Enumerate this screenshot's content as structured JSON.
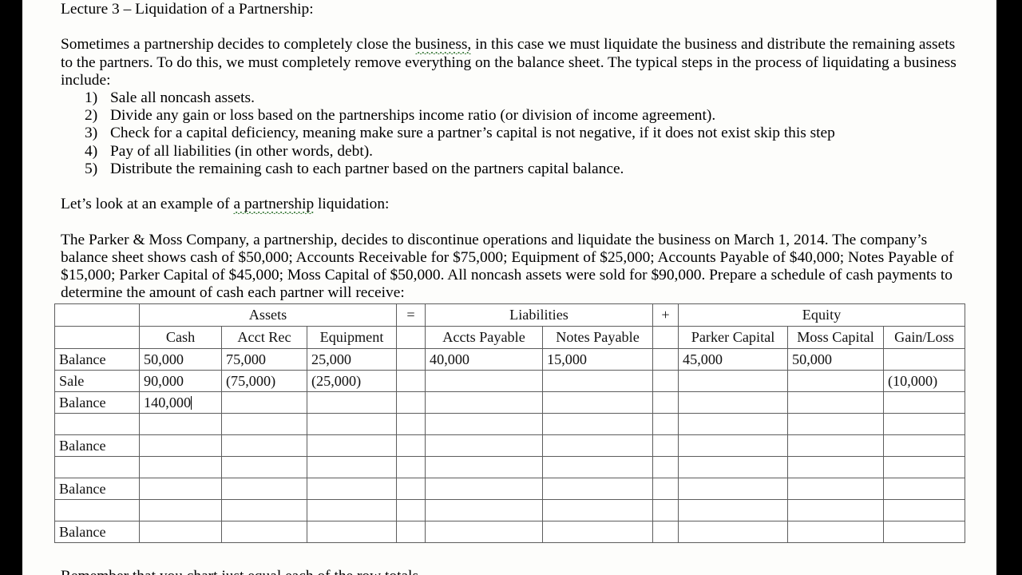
{
  "document": {
    "title_line": "Lecture 3 – Liquidation of a Partnership:",
    "intro_paragraph": "Sometimes a partnership decides to completely close the business, in this case we must liquidate the business and distribute the remaining assets to the partners.  To do this, we must completely remove everything on the balance sheet.  The typical steps in the process of liquidating a business include:",
    "intro_before_flag": "Sometimes a partnership decides to completely close the ",
    "intro_flagged": "business,",
    "intro_after_flag": " in this case we must liquidate the business and distribute the remaining assets to the partners.  To do this, we must completely remove everything on the balance sheet.  The typical steps in the process of liquidating a business include:",
    "steps": [
      {
        "num": "1)",
        "text": "Sale all noncash assets."
      },
      {
        "num": "2)",
        "text": "Divide any gain or loss based on the partnerships income ratio (or division of income agreement)."
      },
      {
        "num": "3)",
        "text": "Check for a capital deficiency, meaning make sure a partner’s capital is not negative, if it does not exist skip this step"
      },
      {
        "num": "4)",
        "text": "Pay of all liabilities (in other words, debt)."
      },
      {
        "num": "5)",
        "text": "Distribute the remaining cash to each partner based on the partners capital balance."
      }
    ],
    "example_lead_before": "Let’s look at an example of ",
    "example_lead_flagged": "a partnership",
    "example_lead_after": " liquidation:",
    "problem_paragraph": "The Parker & Moss Company, a partnership, decides to discontinue operations and liquidate the business on March 1, 2014.  The company’s balance sheet shows cash of $50,000; Accounts Receivable for $75,000; Equipment of $25,000; Accounts Payable of $40,000; Notes Payable of $15,000; Parker Capital of $45,000; Moss Capital of $50,000.  All noncash assets were sold for $90,000.  Prepare a schedule of cash payments to determine the amount of cash each partner will receive:",
    "cut_off_line": "Remember that you chart just equal each of the row totals"
  },
  "table": {
    "group_headers": {
      "blank": "",
      "assets": "Assets",
      "equals": "=",
      "liabilities": "Liabilities",
      "plus": "+",
      "equity": "Equity"
    },
    "column_headers": [
      "",
      "Cash",
      "Acct Rec",
      "Equipment",
      "",
      "Accts Payable",
      "Notes Payable",
      "",
      "Parker Capital",
      "Moss Capital",
      "Gain/Loss"
    ],
    "rows": [
      {
        "label": "Balance",
        "cash": "50,000",
        "acct_rec": "75,000",
        "equipment": "25,000",
        "eq": "",
        "accts_payable": "40,000",
        "notes_payable": "15,000",
        "pl": "",
        "parker_capital": "45,000",
        "moss_capital": "50,000",
        "gain_loss": ""
      },
      {
        "label": "Sale",
        "cash": "90,000",
        "acct_rec": "(75,000)",
        "equipment": "(25,000)",
        "eq": "",
        "accts_payable": "",
        "notes_payable": "",
        "pl": "",
        "parker_capital": "",
        "moss_capital": "",
        "gain_loss": "(10,000)"
      },
      {
        "label": "Balance",
        "cash": "140,000",
        "acct_rec": "",
        "equipment": "",
        "eq": "",
        "accts_payable": "",
        "notes_payable": "",
        "pl": "",
        "parker_capital": "",
        "moss_capital": "",
        "gain_loss": "",
        "caret_after_cash": true
      },
      {
        "label": "",
        "cash": "",
        "acct_rec": "",
        "equipment": "",
        "eq": "",
        "accts_payable": "",
        "notes_payable": "",
        "pl": "",
        "parker_capital": "",
        "moss_capital": "",
        "gain_loss": ""
      },
      {
        "label": "Balance",
        "cash": "",
        "acct_rec": "",
        "equipment": "",
        "eq": "",
        "accts_payable": "",
        "notes_payable": "",
        "pl": "",
        "parker_capital": "",
        "moss_capital": "",
        "gain_loss": ""
      },
      {
        "label": "",
        "cash": "",
        "acct_rec": "",
        "equipment": "",
        "eq": "",
        "accts_payable": "",
        "notes_payable": "",
        "pl": "",
        "parker_capital": "",
        "moss_capital": "",
        "gain_loss": ""
      },
      {
        "label": "Balance",
        "cash": "",
        "acct_rec": "",
        "equipment": "",
        "eq": "",
        "accts_payable": "",
        "notes_payable": "",
        "pl": "",
        "parker_capital": "",
        "moss_capital": "",
        "gain_loss": ""
      },
      {
        "label": "",
        "cash": "",
        "acct_rec": "",
        "equipment": "",
        "eq": "",
        "accts_payable": "",
        "notes_payable": "",
        "pl": "",
        "parker_capital": "",
        "moss_capital": "",
        "gain_loss": ""
      },
      {
        "label": "Balance",
        "cash": "",
        "acct_rec": "",
        "equipment": "",
        "eq": "",
        "accts_payable": "",
        "notes_payable": "",
        "pl": "",
        "parker_capital": "",
        "moss_capital": "",
        "gain_loss": ""
      }
    ]
  },
  "colors": {
    "page_background": "#fdfdfb",
    "letterbox": "#000000",
    "text": "#000000",
    "table_border": "#5d5d5d",
    "grammar_underline": "#3f7d3f"
  }
}
